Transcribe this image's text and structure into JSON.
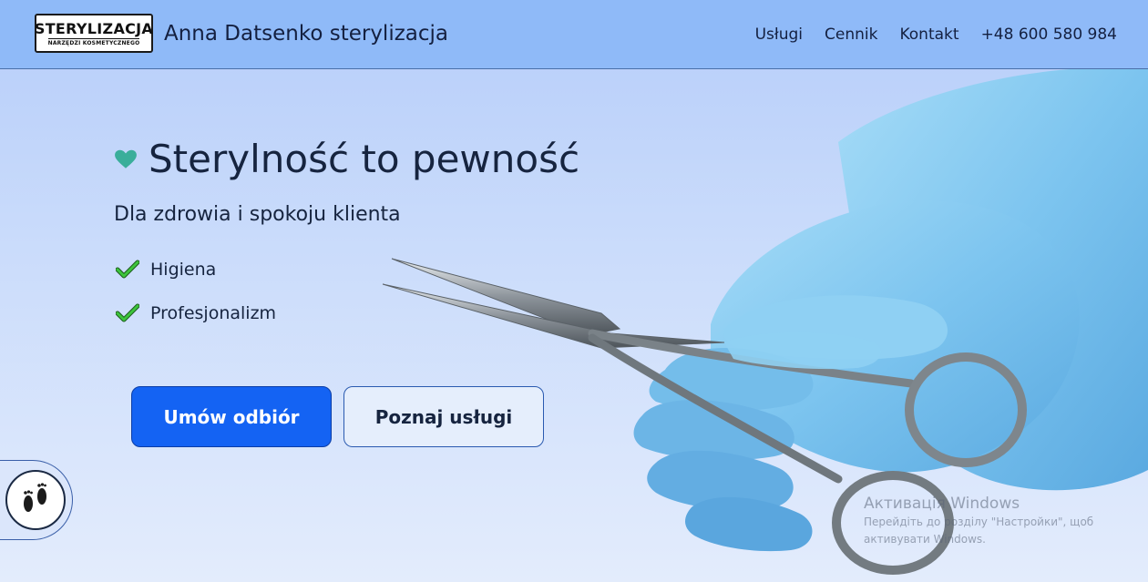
{
  "header": {
    "logo_main": "STERYLIZACJA",
    "logo_sub": "NARZĘDZI KOSMETYCZNEGO",
    "site_title": "Anna Datsenko sterylizacja",
    "nav": [
      {
        "label": "Usługi"
      },
      {
        "label": "Cennik"
      },
      {
        "label": "Kontakt"
      },
      {
        "label": "+48 600 580 984"
      }
    ]
  },
  "hero": {
    "title": "Sterylność to pewność",
    "subtitle": "Dla zdrowia i spokoju klienta",
    "features": [
      {
        "label": "Higiena"
      },
      {
        "label": "Profesjonalizm"
      }
    ],
    "primary_button": "Umów odbiór",
    "secondary_button": "Poznaj usługi"
  },
  "watermark": {
    "title": "Активація Windows",
    "line1": "Перейдіть до розділу \"Настройки\", щоб",
    "line2": "активувати Windows."
  },
  "colors": {
    "header_bg": "#8fbaf8",
    "primary_button": "#1463f3",
    "heart": "#3aae9a",
    "check": "#2fa82f",
    "glove": "#7cc4ef"
  },
  "icons": {
    "heart": "heart-icon",
    "check": "check-icon",
    "accessibility": "footprints-icon"
  }
}
